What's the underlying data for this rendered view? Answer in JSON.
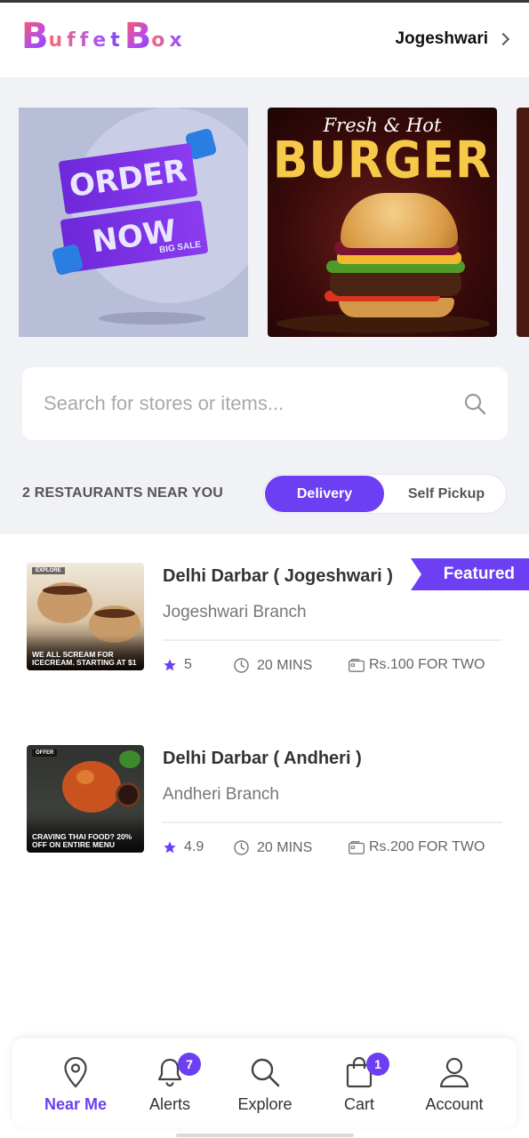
{
  "app": {
    "logo_text_big_1": "B",
    "logo_text_small_1": "uffet",
    "logo_text_big_2": "B",
    "logo_text_small_2": "ox",
    "location": "Jogeshwari"
  },
  "banners": {
    "banner1_line1": "ORDER",
    "banner1_line2": "NOW",
    "banner1_tag": "BIG SALE",
    "banner2_line1": "Fresh & Hot",
    "banner2_line2": "BURGER"
  },
  "search": {
    "placeholder": "Search for stores or items..."
  },
  "listing": {
    "count_label": "2 RESTAURANTS NEAR YOU",
    "mode_delivery": "Delivery",
    "mode_pickup": "Self Pickup",
    "active_mode": "Delivery"
  },
  "restaurants": [
    {
      "name": "Delhi Darbar ( Jogeshwari )",
      "branch": "Jogeshwari Branch",
      "rating": "5",
      "time": "20 MINS",
      "price": "Rs.100 FOR TWO",
      "badge": "Featured",
      "thumb_tag": "EXPLORE",
      "thumb_caption": "WE ALL SCREAM FOR ICECREAM. STARTING AT $1"
    },
    {
      "name": "Delhi Darbar ( Andheri )",
      "branch": "Andheri Branch",
      "rating": "4.9",
      "time": "20 MINS",
      "price": "Rs.200 FOR TWO",
      "thumb_tag": "OFFER",
      "thumb_caption": "CRAVING THAI FOOD? 20% OFF ON ENTIRE MENU"
    }
  ],
  "nav": {
    "items": [
      {
        "label": "Near Me",
        "icon": "map-pin-icon",
        "active": true
      },
      {
        "label": "Alerts",
        "icon": "bell-icon",
        "badge": "7"
      },
      {
        "label": "Explore",
        "icon": "search-icon"
      },
      {
        "label": "Cart",
        "icon": "shopping-bag-icon",
        "badge": "1"
      },
      {
        "label": "Account",
        "icon": "user-icon"
      }
    ]
  },
  "colors": {
    "accent": "#6c3ff2",
    "background_grey": "#f1f2f6",
    "text_dark": "#333333",
    "text_muted": "#777777"
  }
}
